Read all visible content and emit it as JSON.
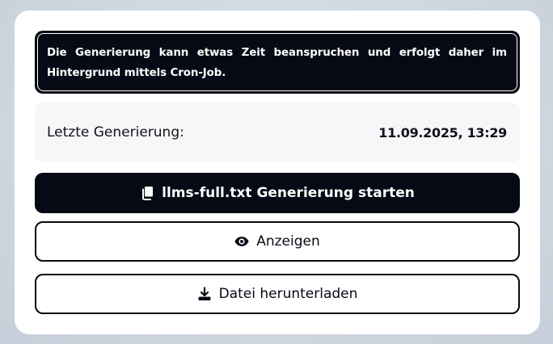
{
  "notice": {
    "text": "Die Generierung kann etwas Zeit beanspruchen und erfolgt daher im Hintergrund mittels Cron-Job."
  },
  "last_generation": {
    "label": "Letzte Generierung:",
    "value": "11.09.2025, 13:29"
  },
  "buttons": {
    "start": {
      "label": "llms-full.txt Generierung starten",
      "icon": "copy-files-icon"
    },
    "show": {
      "label": "Anzeigen",
      "icon": "eye-icon"
    },
    "download": {
      "label": "Datei herunterladen",
      "icon": "download-icon"
    }
  },
  "colors": {
    "primary": "#050a14",
    "info_background": "#f6f7f9",
    "card_background": "#ffffff"
  }
}
